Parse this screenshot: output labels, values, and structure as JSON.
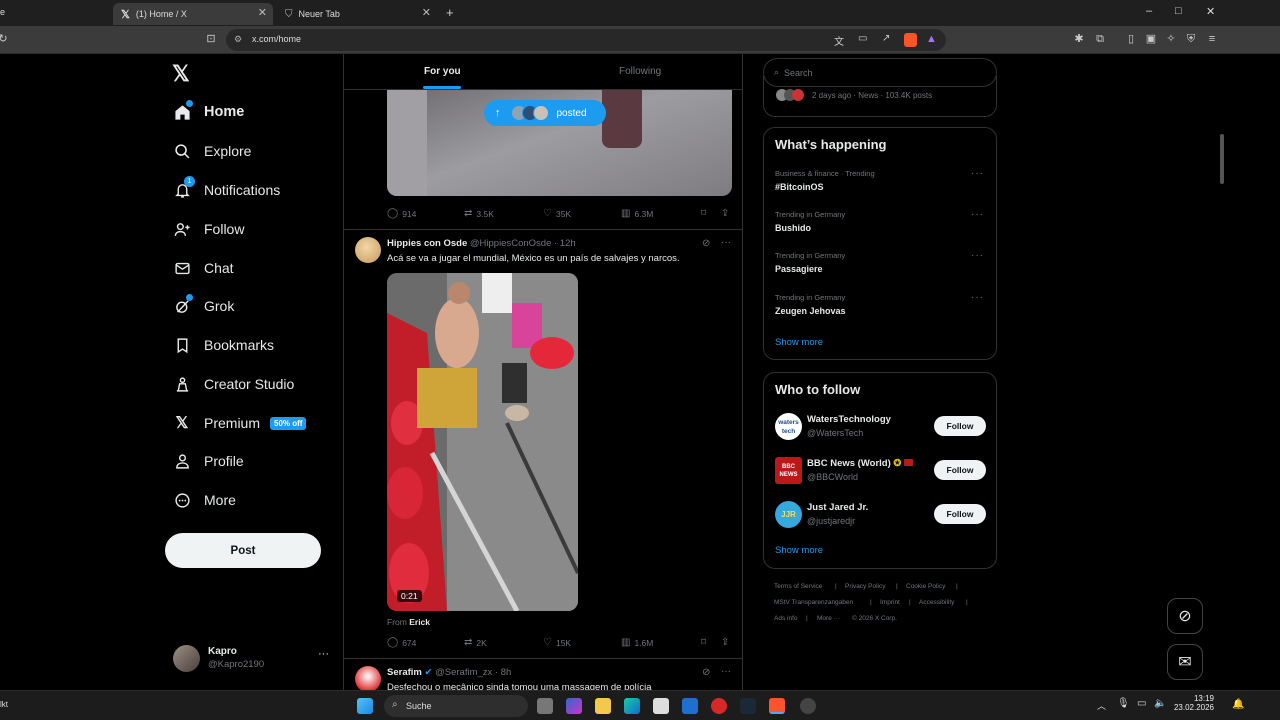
{
  "browser": {
    "tabs": [
      {
        "title": "(1) Home / X",
        "favicon": "x-logo"
      },
      {
        "title": "Neuer Tab",
        "favicon": "brave-shield"
      }
    ],
    "left_tab_fragment": "e",
    "url": "x.com/home",
    "new_tab_symbol": "+",
    "window_controls": [
      "–",
      "□",
      "✕"
    ]
  },
  "nav": {
    "logo": "𝕏",
    "items": [
      {
        "label": "Home",
        "icon": "home-icon"
      },
      {
        "label": "Explore",
        "icon": "search-icon"
      },
      {
        "label": "Notifications",
        "icon": "bell-icon",
        "badge": "1"
      },
      {
        "label": "Follow",
        "icon": "person-add-icon"
      },
      {
        "label": "Chat",
        "icon": "mail-icon"
      },
      {
        "label": "Grok",
        "icon": "grok-icon"
      },
      {
        "label": "Bookmarks",
        "icon": "bookmark-icon"
      },
      {
        "label": "Creator Studio",
        "icon": "creator-icon"
      },
      {
        "label": "Premium",
        "icon": "x-icon",
        "badge": "50% off"
      },
      {
        "label": "Profile",
        "icon": "person-icon"
      },
      {
        "label": "More",
        "icon": "more-circle-icon"
      }
    ],
    "post_button": "Post",
    "account": {
      "name": "Kapro",
      "handle": "@Kapro2190",
      "more": "···"
    }
  },
  "timeline": {
    "tabs": {
      "for_you": "For you",
      "following": "Following"
    },
    "posted_pill": "posted",
    "post1_stats": {
      "replies": "914",
      "reposts": "3.5K",
      "likes": "35K",
      "views": "6.3M"
    },
    "post2": {
      "name": "Hippies con Osde",
      "handle": "@HippiesConOsde",
      "time": "· 12h",
      "text": "Acá se va a jugar el mundial, México es un país de salvajes y narcos.",
      "video_duration": "0:21",
      "from_label": "From",
      "from_user": "Erick",
      "stats": {
        "replies": "674",
        "reposts": "2K",
        "likes": "15K",
        "views": "1.6M"
      }
    },
    "post3": {
      "name": "Serafim",
      "handle": "@Serafim_zx",
      "time": "· 8h",
      "text": "Desfechou o mecânico sinda tomou uma massagem de polícia"
    }
  },
  "right": {
    "search_placeholder": "Search",
    "top_snippet": "2 days ago · News · 103.4K posts",
    "whats_happening": {
      "title": "What’s happening",
      "trends": [
        {
          "context": "Business & finance · Trending",
          "name": "#BitcoinOS"
        },
        {
          "context": "Trending in Germany",
          "name": "Bushido"
        },
        {
          "context": "Trending in Germany",
          "name": "Passagiere"
        },
        {
          "context": "Trending in Germany",
          "name": "Zeugen Jehovas"
        }
      ],
      "show_more": "Show more"
    },
    "who_to_follow": {
      "title": "Who to follow",
      "accounts": [
        {
          "name": "WatersTechnology",
          "handle": "@WatersTech",
          "avatar_text": "waters tech"
        },
        {
          "name": "BBC News (World)",
          "handle": "@BBCWorld",
          "avatar_text": "BBC NEWS"
        },
        {
          "name": "Just Jared Jr.",
          "handle": "@justjaredjr",
          "avatar_text": "JJR"
        }
      ],
      "follow_label": "Follow",
      "show_more": "Show more"
    },
    "footer": {
      "row1": [
        "Terms of Service",
        "|",
        "Privacy Policy",
        "|",
        "Cookie Policy",
        "|"
      ],
      "row2": [
        "MStV Transparenzangaben",
        "|",
        "Imprint",
        "|",
        "Accessibility",
        "|"
      ],
      "row3": [
        "Ads info",
        "|",
        "More ···",
        "© 2026 X Corp."
      ]
    }
  },
  "taskbar": {
    "left_fragment": "lkt",
    "search_label": "Suche",
    "time": "13:19",
    "date": "23.02.2026"
  },
  "colors": {
    "accent": "#1d9bf0",
    "background": "#000000",
    "border": "#2f3336",
    "muted": "#71767b"
  }
}
